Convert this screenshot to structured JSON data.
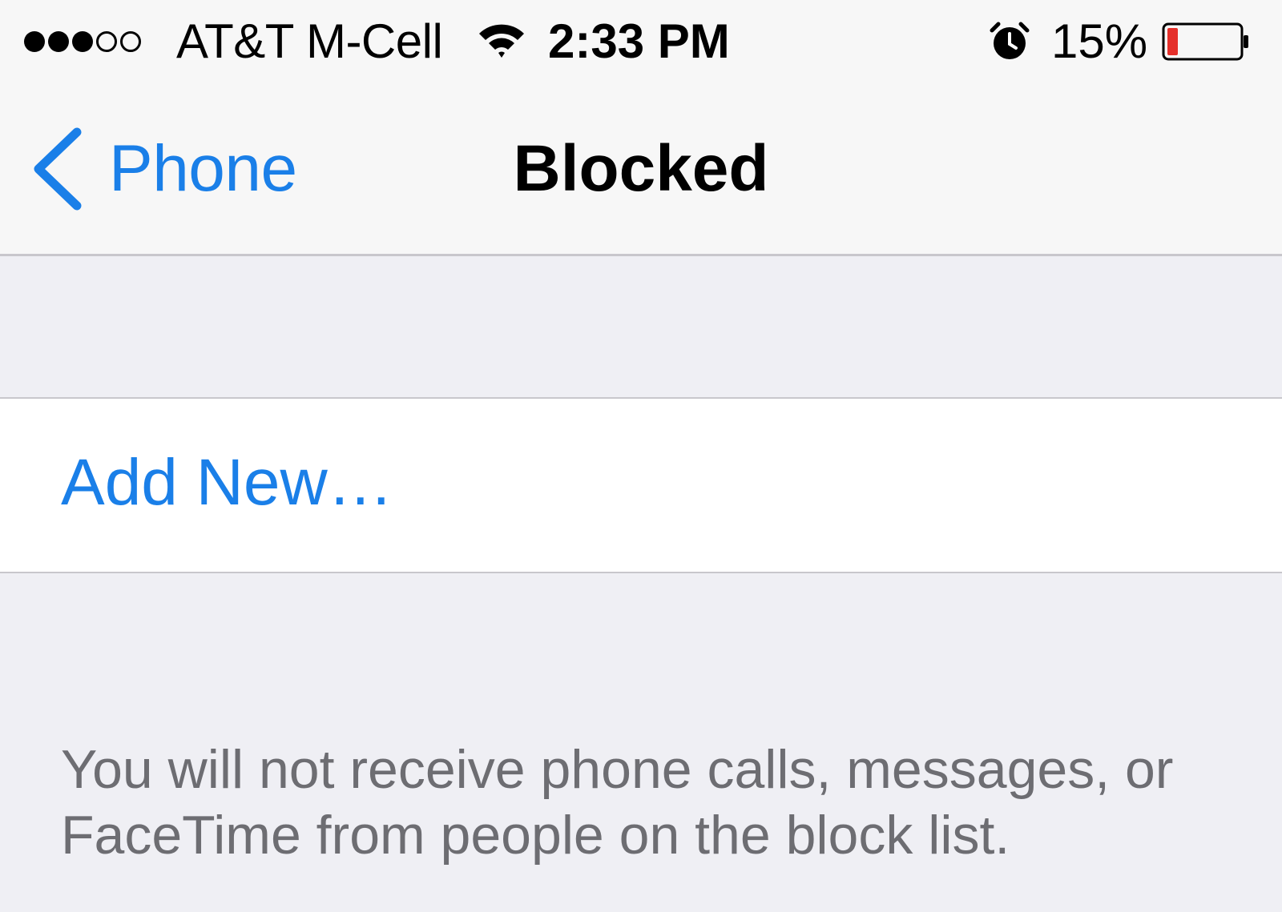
{
  "status_bar": {
    "signal_bars_filled": 3,
    "signal_bars_total": 5,
    "carrier": "AT&T M-Cell",
    "time": "2:33 PM",
    "battery_percent_text": "15%",
    "battery_level": 0.15,
    "icons": [
      "wifi-icon",
      "alarm-icon",
      "battery-icon"
    ]
  },
  "nav": {
    "back_label": "Phone",
    "title": "Blocked"
  },
  "list": {
    "add_new_label": "Add New…"
  },
  "footer": {
    "note": "You will not receive phone calls, messages, or FaceTime from people on the block list."
  },
  "colors": {
    "accent": "#1a7fe8",
    "background": "#efeff4",
    "bar_background": "#f7f7f7",
    "battery_low": "#e5302b"
  }
}
